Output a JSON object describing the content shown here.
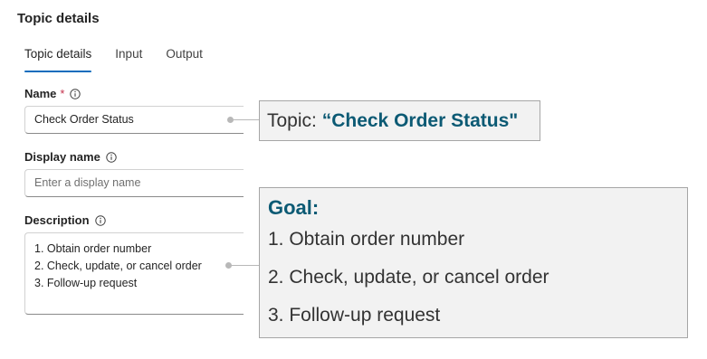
{
  "panel": {
    "title": "Topic details"
  },
  "tabs": [
    {
      "label": "Topic details",
      "active": true
    },
    {
      "label": "Input",
      "active": false
    },
    {
      "label": "Output",
      "active": false
    }
  ],
  "fields": {
    "name": {
      "label": "Name",
      "required_marker": "*",
      "value": "Check Order Status"
    },
    "display_name": {
      "label": "Display name",
      "value": "",
      "placeholder": "Enter a display name"
    },
    "description": {
      "label": "Description",
      "lines": [
        "1. Obtain order number",
        "2. Check, update, or cancel order",
        "3. Follow-up request"
      ]
    }
  },
  "callouts": {
    "topic": {
      "prefix": "Topic: ",
      "highlight": "“Check Order Status\""
    },
    "goal": {
      "heading": "Goal:",
      "items": [
        "1. Obtain order number",
        "2. Check, update, or cancel order",
        "3. Follow-up request"
      ]
    }
  },
  "colors": {
    "accent": "#0f6cbd",
    "callout_highlight": "#0c5a74",
    "required": "#c4314b",
    "callout_bg": "#f2f2f2"
  },
  "icons": {
    "info": "info-icon"
  }
}
